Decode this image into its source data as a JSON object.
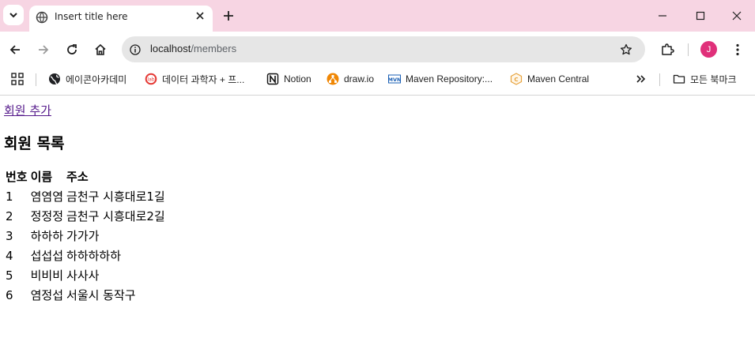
{
  "browser": {
    "tab": {
      "title": "Insert title here",
      "icon": "globe-icon"
    },
    "url": {
      "host": "localhost",
      "path": "/members"
    },
    "profile_initial": "J",
    "colors": {
      "tabstrip": "#f7d5e3",
      "avatar": "#e0307a",
      "visited_link": "#551a8b"
    }
  },
  "bookmarks": {
    "items": [
      {
        "label": "에이콘아카데미",
        "icon": "globe-icon"
      },
      {
        "label": "데이터 과학자 + 프...",
        "icon": "lab-icon"
      },
      {
        "label": "Notion",
        "icon": "notion-icon"
      },
      {
        "label": "draw.io",
        "icon": "drawio-icon"
      },
      {
        "label": "Maven Repository:...",
        "icon": "mvn-icon"
      },
      {
        "label": "Maven Central",
        "icon": "maven-central-icon"
      }
    ],
    "all_bookmarks": "모든 북마크"
  },
  "page": {
    "add_link": "회원 추가",
    "heading": "회원 목록",
    "table": {
      "headers": [
        "번호",
        "이름",
        "주소"
      ],
      "rows": [
        [
          "1",
          "염염염",
          "금천구 시흥대로1길"
        ],
        [
          "2",
          "정정정",
          "금천구 시흥대로2길"
        ],
        [
          "3",
          "하하하",
          "가가가"
        ],
        [
          "4",
          "섭섭섭",
          "하하하하하"
        ],
        [
          "5",
          "비비비",
          "사사사"
        ],
        [
          "6",
          "염정섭",
          "서울시 동작구"
        ]
      ]
    }
  }
}
